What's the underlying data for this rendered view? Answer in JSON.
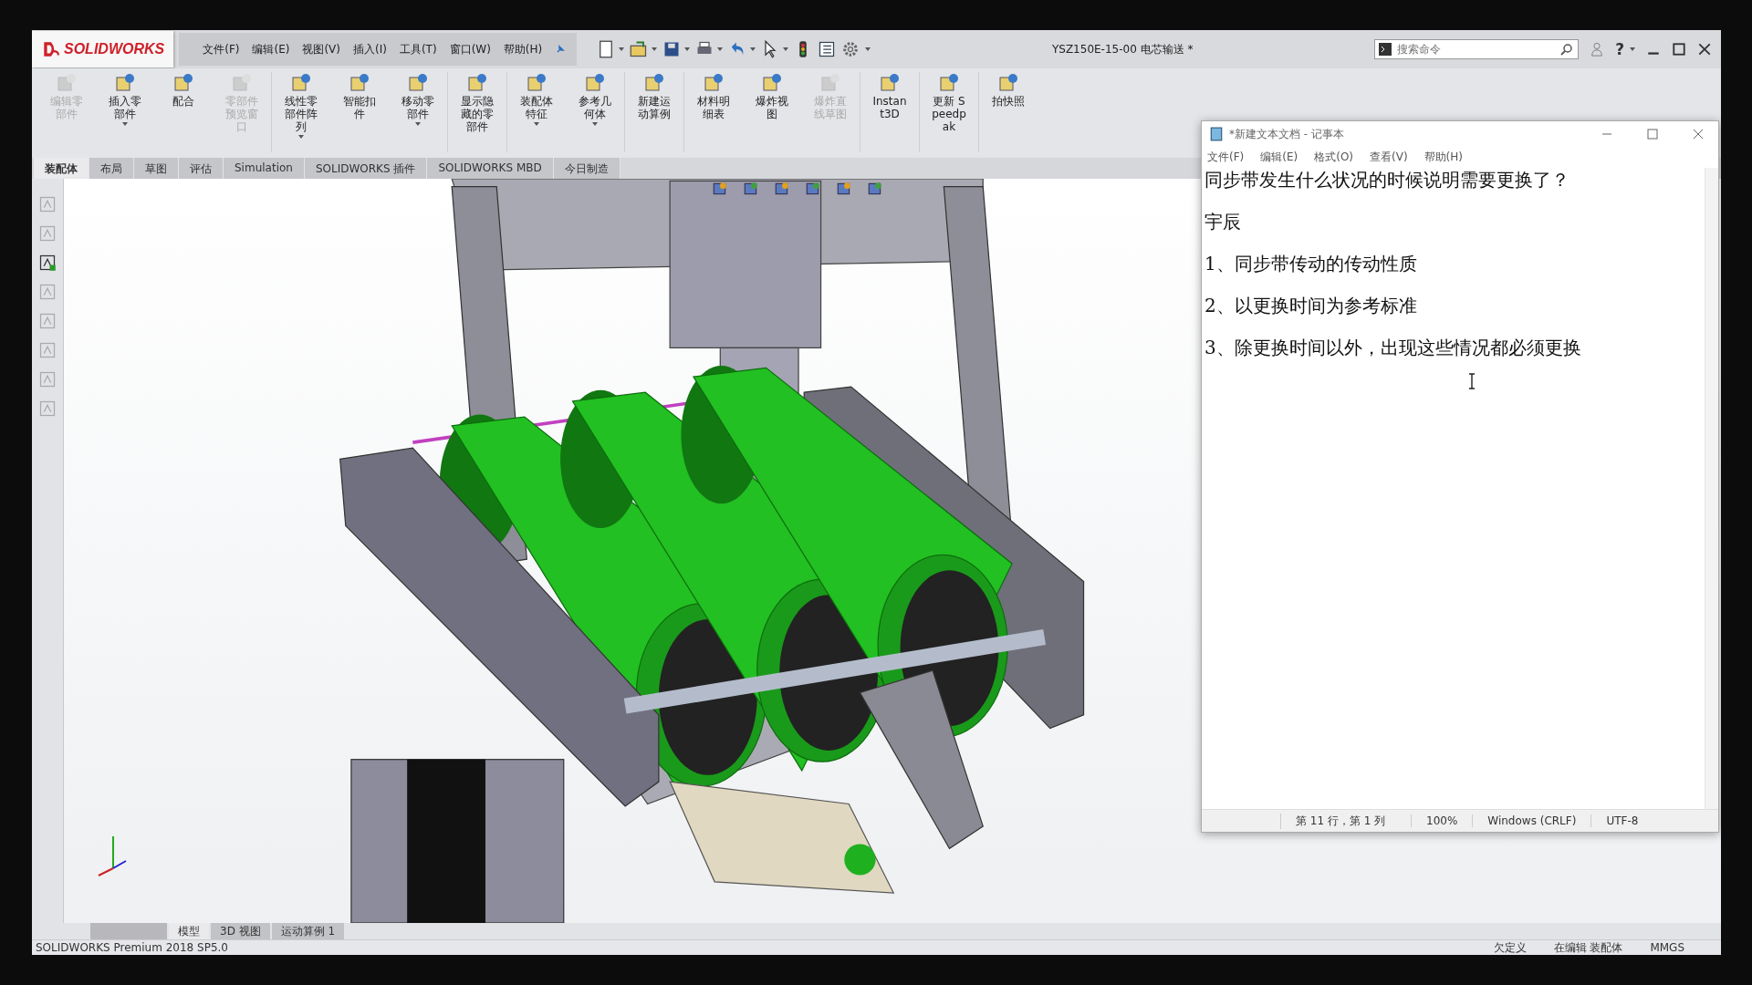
{
  "app": {
    "brand": "SOLIDWORKS",
    "menus": [
      "文件(F)",
      "编辑(E)",
      "视图(V)",
      "插入(I)",
      "工具(T)",
      "窗口(W)",
      "帮助(H)"
    ],
    "document_title": "YSZ150E-15-00 电芯输送 *",
    "search": {
      "placeholder": "搜索命令"
    },
    "help": "?"
  },
  "ribbon": [
    {
      "label": "编辑零部件",
      "disabled": true,
      "dropdown": false,
      "group_start": false
    },
    {
      "label": "插入零部件",
      "disabled": false,
      "dropdown": true,
      "group_start": false
    },
    {
      "label": "配合",
      "disabled": false,
      "dropdown": false,
      "group_start": false
    },
    {
      "label": "零部件预览窗口",
      "disabled": true,
      "dropdown": false,
      "group_start": false
    },
    {
      "label": "线性零部件阵列",
      "disabled": false,
      "dropdown": true,
      "group_start": true
    },
    {
      "label": "智能扣件",
      "disabled": false,
      "dropdown": false,
      "group_start": false
    },
    {
      "label": "移动零部件",
      "disabled": false,
      "dropdown": true,
      "group_start": false
    },
    {
      "label": "显示隐藏的零部件",
      "disabled": false,
      "dropdown": false,
      "group_start": true
    },
    {
      "label": "装配体特征",
      "disabled": false,
      "dropdown": true,
      "group_start": true
    },
    {
      "label": "参考几何体",
      "disabled": false,
      "dropdown": true,
      "group_start": false
    },
    {
      "label": "新建运动算例",
      "disabled": false,
      "dropdown": false,
      "group_start": true
    },
    {
      "label": "材料明细表",
      "disabled": false,
      "dropdown": false,
      "group_start": true
    },
    {
      "label": "爆炸视图",
      "disabled": false,
      "dropdown": false,
      "group_start": false
    },
    {
      "label": "爆炸直线草图",
      "disabled": true,
      "dropdown": false,
      "group_start": false
    },
    {
      "label": "Instant3D",
      "disabled": false,
      "dropdown": false,
      "group_start": true
    },
    {
      "label": "更新 Speedpak",
      "disabled": false,
      "dropdown": false,
      "group_start": true
    },
    {
      "label": "拍快照",
      "disabled": false,
      "dropdown": false,
      "group_start": true
    }
  ],
  "command_tabs": [
    {
      "label": "装配体",
      "selected": true
    },
    {
      "label": "布局",
      "selected": false
    },
    {
      "label": "草图",
      "selected": false
    },
    {
      "label": "评估",
      "selected": false
    },
    {
      "label": "Simulation",
      "selected": false
    },
    {
      "label": "SOLIDWORKS 插件",
      "selected": false
    },
    {
      "label": "SOLIDWORKS MBD",
      "selected": false
    },
    {
      "label": "今日制造",
      "selected": false
    }
  ],
  "notepad": {
    "title": "*新建文本文档 - 记事本",
    "menus": [
      "文件(F)",
      "编辑(E)",
      "格式(O)",
      "查看(V)",
      "帮助(H)"
    ],
    "lines": [
      "同步带发生什么状况的时候说明需要更换了？",
      "宇辰",
      "1、同步带传动的传动性质",
      "2、以更换时间为参考标准",
      "3、除更换时间以外，出现这些情况都必须更换"
    ],
    "status": [
      "第 11 行，第 1 列",
      "100%",
      "Windows (CRLF)",
      "UTF-8"
    ]
  },
  "bottom_tabs": [
    {
      "label": "模型",
      "selected": true
    },
    {
      "label": "3D 视图",
      "selected": false
    },
    {
      "label": "运动算例 1",
      "selected": false
    }
  ],
  "status_bar": {
    "product": "SOLIDWORKS Premium 2018 SP5.0",
    "items": [
      "欠定义",
      "在编辑 装配体",
      "MMGS"
    ]
  }
}
